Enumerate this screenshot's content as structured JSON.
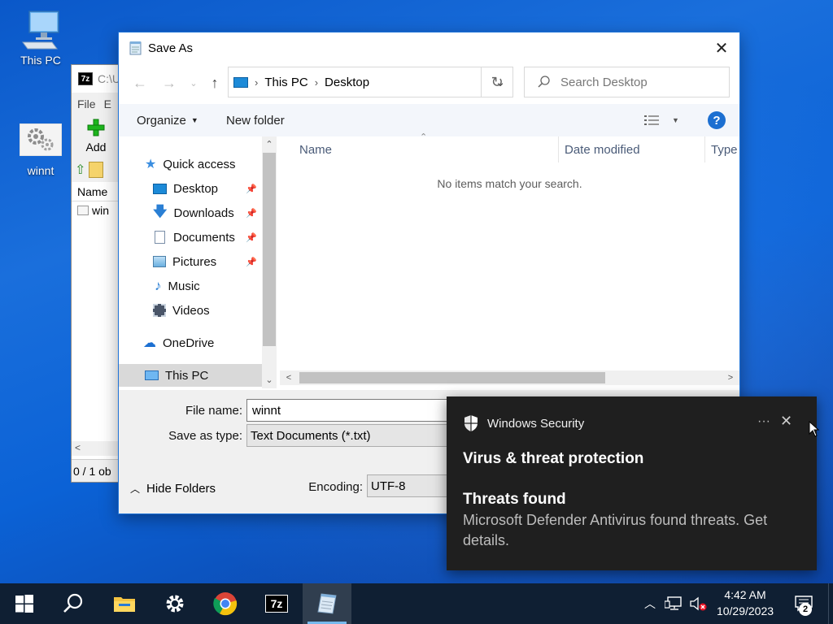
{
  "desktop": {
    "icons": [
      {
        "label": "This PC",
        "icon": "computer-icon"
      },
      {
        "label": "winnt",
        "icon": "settings-file-icon"
      }
    ]
  },
  "zip_window": {
    "title": "C:\\U",
    "menu_file": "File",
    "menu_edit": "E",
    "toolbar_add": "Add",
    "col_name": "Name",
    "row_name": "win",
    "status": "0 / 1 ob"
  },
  "save_dialog": {
    "title": "Save As",
    "breadcrumb": [
      "This PC",
      "Desktop"
    ],
    "search_placeholder": "Search Desktop",
    "organize": "Organize",
    "new_folder": "New folder",
    "help": "?",
    "nav": {
      "quick_access": "Quick access",
      "items": [
        {
          "label": "Desktop",
          "pinned": true
        },
        {
          "label": "Downloads",
          "pinned": true
        },
        {
          "label": "Documents",
          "pinned": true
        },
        {
          "label": "Pictures",
          "pinned": true
        },
        {
          "label": "Music",
          "pinned": false
        },
        {
          "label": "Videos",
          "pinned": false
        }
      ],
      "onedrive": "OneDrive",
      "this_pc": "This PC"
    },
    "columns": [
      "Name",
      "Date modified",
      "Type"
    ],
    "empty_message": "No items match your search.",
    "file_name_label": "File name:",
    "file_name_value": "winnt",
    "save_type_label": "Save as type:",
    "save_type_value": "Text Documents (*.txt)",
    "hide_folders": "Hide Folders",
    "encoding_label": "Encoding:",
    "encoding_value": "UTF-8"
  },
  "toast": {
    "app": "Windows Security",
    "title": "Virus & threat protection",
    "subtitle": "Threats found",
    "body": "Microsoft Defender Antivirus found threats. Get details."
  },
  "taskbar": {
    "apps": [
      "start",
      "search",
      "file-explorer",
      "settings",
      "chrome",
      "7zip",
      "notepad"
    ],
    "time": "4:42 AM",
    "date": "10/29/2023",
    "notification_count": "2"
  },
  "colors": {
    "accent": "#1c6fd1",
    "taskbar": "#0f1f33",
    "toast_bg": "#1f1f1f"
  }
}
